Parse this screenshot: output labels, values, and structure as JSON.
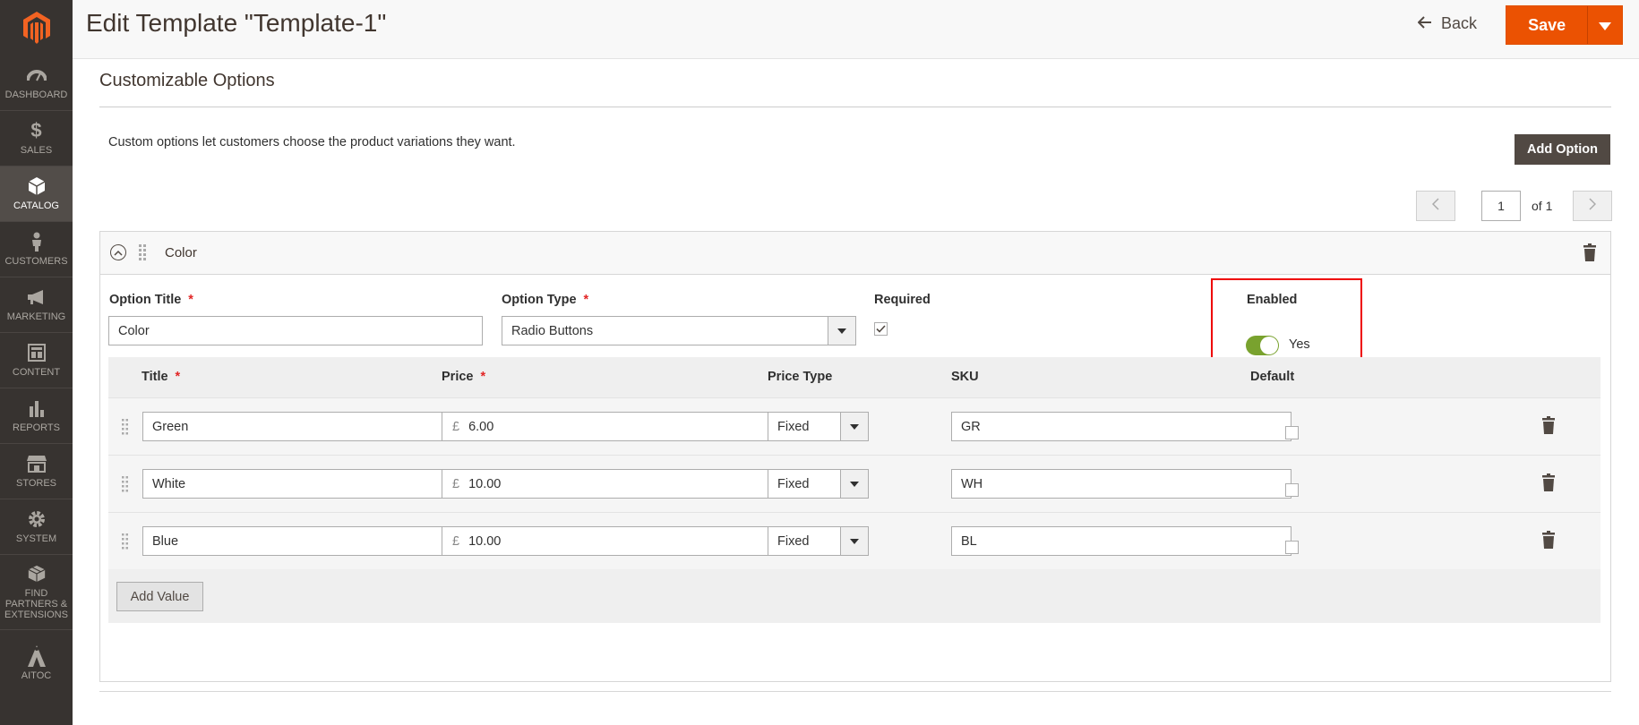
{
  "header": {
    "title": "Edit Template \"Template-1\"",
    "back_label": "Back",
    "save_label": "Save"
  },
  "sidebar": {
    "items": [
      {
        "label": "DASHBOARD",
        "icon": "dashboard-icon"
      },
      {
        "label": "SALES",
        "icon": "dollar-icon"
      },
      {
        "label": "CATALOG",
        "icon": "cube-icon"
      },
      {
        "label": "CUSTOMERS",
        "icon": "person-icon"
      },
      {
        "label": "MARKETING",
        "icon": "megaphone-icon"
      },
      {
        "label": "CONTENT",
        "icon": "layout-icon"
      },
      {
        "label": "REPORTS",
        "icon": "bar-chart-icon"
      },
      {
        "label": "STORES",
        "icon": "store-icon"
      },
      {
        "label": "SYSTEM",
        "icon": "gear-icon"
      },
      {
        "label": "FIND PARTNERS & EXTENSIONS",
        "icon": "boxes-icon"
      },
      {
        "label": "AITOC",
        "icon": "aitoc-icon"
      }
    ]
  },
  "section": {
    "title": "Customizable Options",
    "description": "Custom options let customers choose the product variations they want.",
    "add_option_label": "Add Option"
  },
  "pager": {
    "current": "1",
    "of_label": "of 1"
  },
  "option": {
    "name": "Color",
    "title_label": "Option Title",
    "title_value": "Color",
    "type_label": "Option Type",
    "type_value": "Radio Buttons",
    "required_label": "Required",
    "required_checked": true,
    "enabled_label": "Enabled",
    "enabled_value": "Yes",
    "required_marker": "*"
  },
  "values": {
    "headers": {
      "title": "Title",
      "price": "Price",
      "price_type": "Price Type",
      "sku": "SKU",
      "default": "Default"
    },
    "rows": [
      {
        "title": "Green",
        "currency": "£",
        "price": "6.00",
        "price_type": "Fixed",
        "sku": "GR"
      },
      {
        "title": "White",
        "currency": "£",
        "price": "10.00",
        "price_type": "Fixed",
        "sku": "WH"
      },
      {
        "title": "Blue",
        "currency": "£",
        "price": "10.00",
        "price_type": "Fixed",
        "sku": "BL"
      }
    ],
    "add_value_label": "Add Value"
  },
  "colors": {
    "accent": "#eb5202",
    "sidebar_bg": "#373330",
    "toggle_on": "#79a22e",
    "highlight_border": "#ee0000"
  }
}
